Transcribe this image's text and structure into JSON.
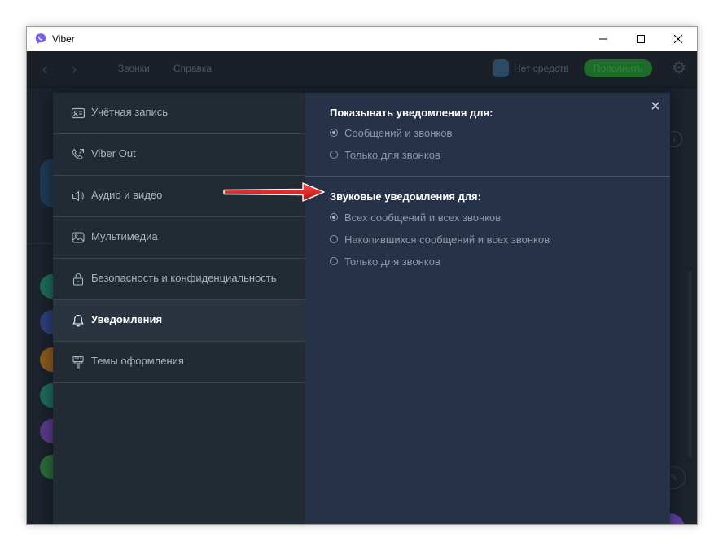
{
  "window": {
    "title": "Viber"
  },
  "background_app": {
    "nav": [
      "Звонки",
      "Справка"
    ],
    "username": "Нет средств",
    "topup_label": "Пополнить"
  },
  "settings": {
    "menu": [
      {
        "label": "Учётная запись",
        "icon": "account-card-icon",
        "active": false
      },
      {
        "label": "Viber Out",
        "icon": "phone-icon",
        "active": false
      },
      {
        "label": "Аудио и видео",
        "icon": "speaker-icon",
        "active": false
      },
      {
        "label": "Мультимедиа",
        "icon": "media-icon",
        "active": false
      },
      {
        "label": "Безопасность и конфиденциальность",
        "icon": "lock-icon",
        "active": false
      },
      {
        "label": "Уведомления",
        "icon": "bell-icon",
        "active": true
      },
      {
        "label": "Темы оформления",
        "icon": "brush-icon",
        "active": false
      }
    ],
    "notifications": {
      "show_title": "Показывать уведомления для:",
      "show_options": [
        {
          "label": "Сообщений и звонков",
          "checked": true
        },
        {
          "label": "Только для звонков",
          "checked": false
        }
      ],
      "sound_title": "Звуковые уведомления для:",
      "sound_options": [
        {
          "label": "Всех сообщений и всех звонков",
          "checked": true
        },
        {
          "label": "Накопившихся сообщений и всех звонков",
          "checked": false
        },
        {
          "label": "Только для звонков",
          "checked": false
        }
      ]
    }
  },
  "colors": {
    "accent_arrow": "#d01818",
    "viber_purple": "#7360f2"
  }
}
